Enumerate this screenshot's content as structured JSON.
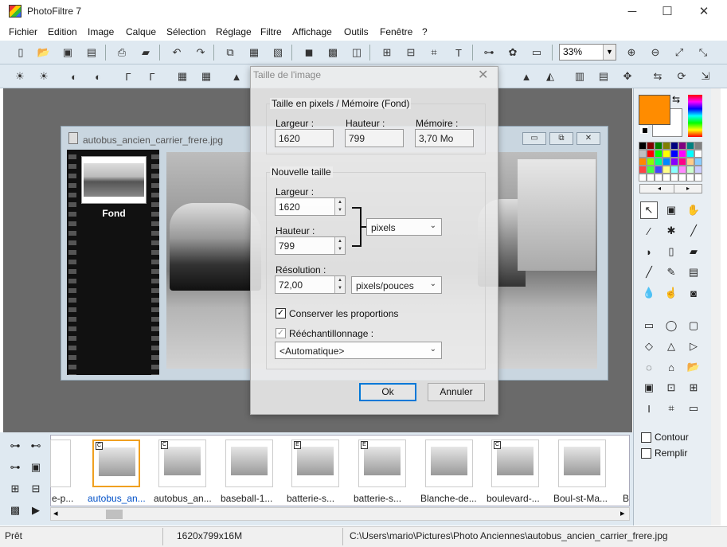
{
  "window": {
    "title": "PhotoFiltre 7",
    "minimize": "─",
    "maximize": "☐",
    "close": "✕"
  },
  "menu": [
    "Fichier",
    "Edition",
    "Image",
    "Calque",
    "Sélection",
    "Réglage",
    "Filtre",
    "Affichage",
    "Outils",
    "Fenêtre",
    "?"
  ],
  "toolbar": {
    "zoom": "33%"
  },
  "image_window": {
    "title": "autobus_ancien_carrier_frere.jpg",
    "layer_label": "Fond",
    "min": "▭",
    "restore": "⧉",
    "close": "✕"
  },
  "dialog": {
    "title": "Taille de l'image",
    "close": "✕",
    "current_group": "Taille en pixels / Mémoire (Fond)",
    "current": {
      "width_label": "Largeur :",
      "width_value": "1620",
      "height_label": "Hauteur :",
      "height_value": "799",
      "memory_label": "Mémoire :",
      "memory_value": "3,70 Mo"
    },
    "new_group": "Nouvelle taille",
    "new": {
      "width_label": "Largeur :",
      "width_value": "1620",
      "height_label": "Hauteur :",
      "height_value": "799",
      "unit": "pixels",
      "resolution_label": "Résolution :",
      "resolution_value": "72,00",
      "resolution_unit": "pixels/pouces"
    },
    "keep_proportions": "Conserver les proportions",
    "resample": "Rééchantillonnage :",
    "resample_mode": "<Automatique>",
    "ok": "Ok",
    "cancel": "Annuler"
  },
  "right_panel": {
    "outline": "Contour",
    "fill": "Remplir",
    "fg_color": "#ff8c00"
  },
  "thumbnails": [
    {
      "label": "e-p...",
      "tag": ""
    },
    {
      "label": "autobus_an...",
      "tag": "C",
      "selected": true
    },
    {
      "label": "autobus_an...",
      "tag": "C"
    },
    {
      "label": "baseball-1...",
      "tag": ""
    },
    {
      "label": "batterie-s...",
      "tag": "E"
    },
    {
      "label": "batterie-s...",
      "tag": "E"
    },
    {
      "label": "Blanche-de...",
      "tag": ""
    },
    {
      "label": "boulevard-...",
      "tag": "C"
    },
    {
      "label": "Boul-st-Ma...",
      "tag": ""
    },
    {
      "label": "B",
      "tag": ""
    }
  ],
  "status": {
    "state": "Prêt",
    "size": "1620x799x16M",
    "path": "C:\\Users\\mario\\Pictures\\Photo Anciennes\\autobus_ancien_carrier_frere.jpg"
  }
}
